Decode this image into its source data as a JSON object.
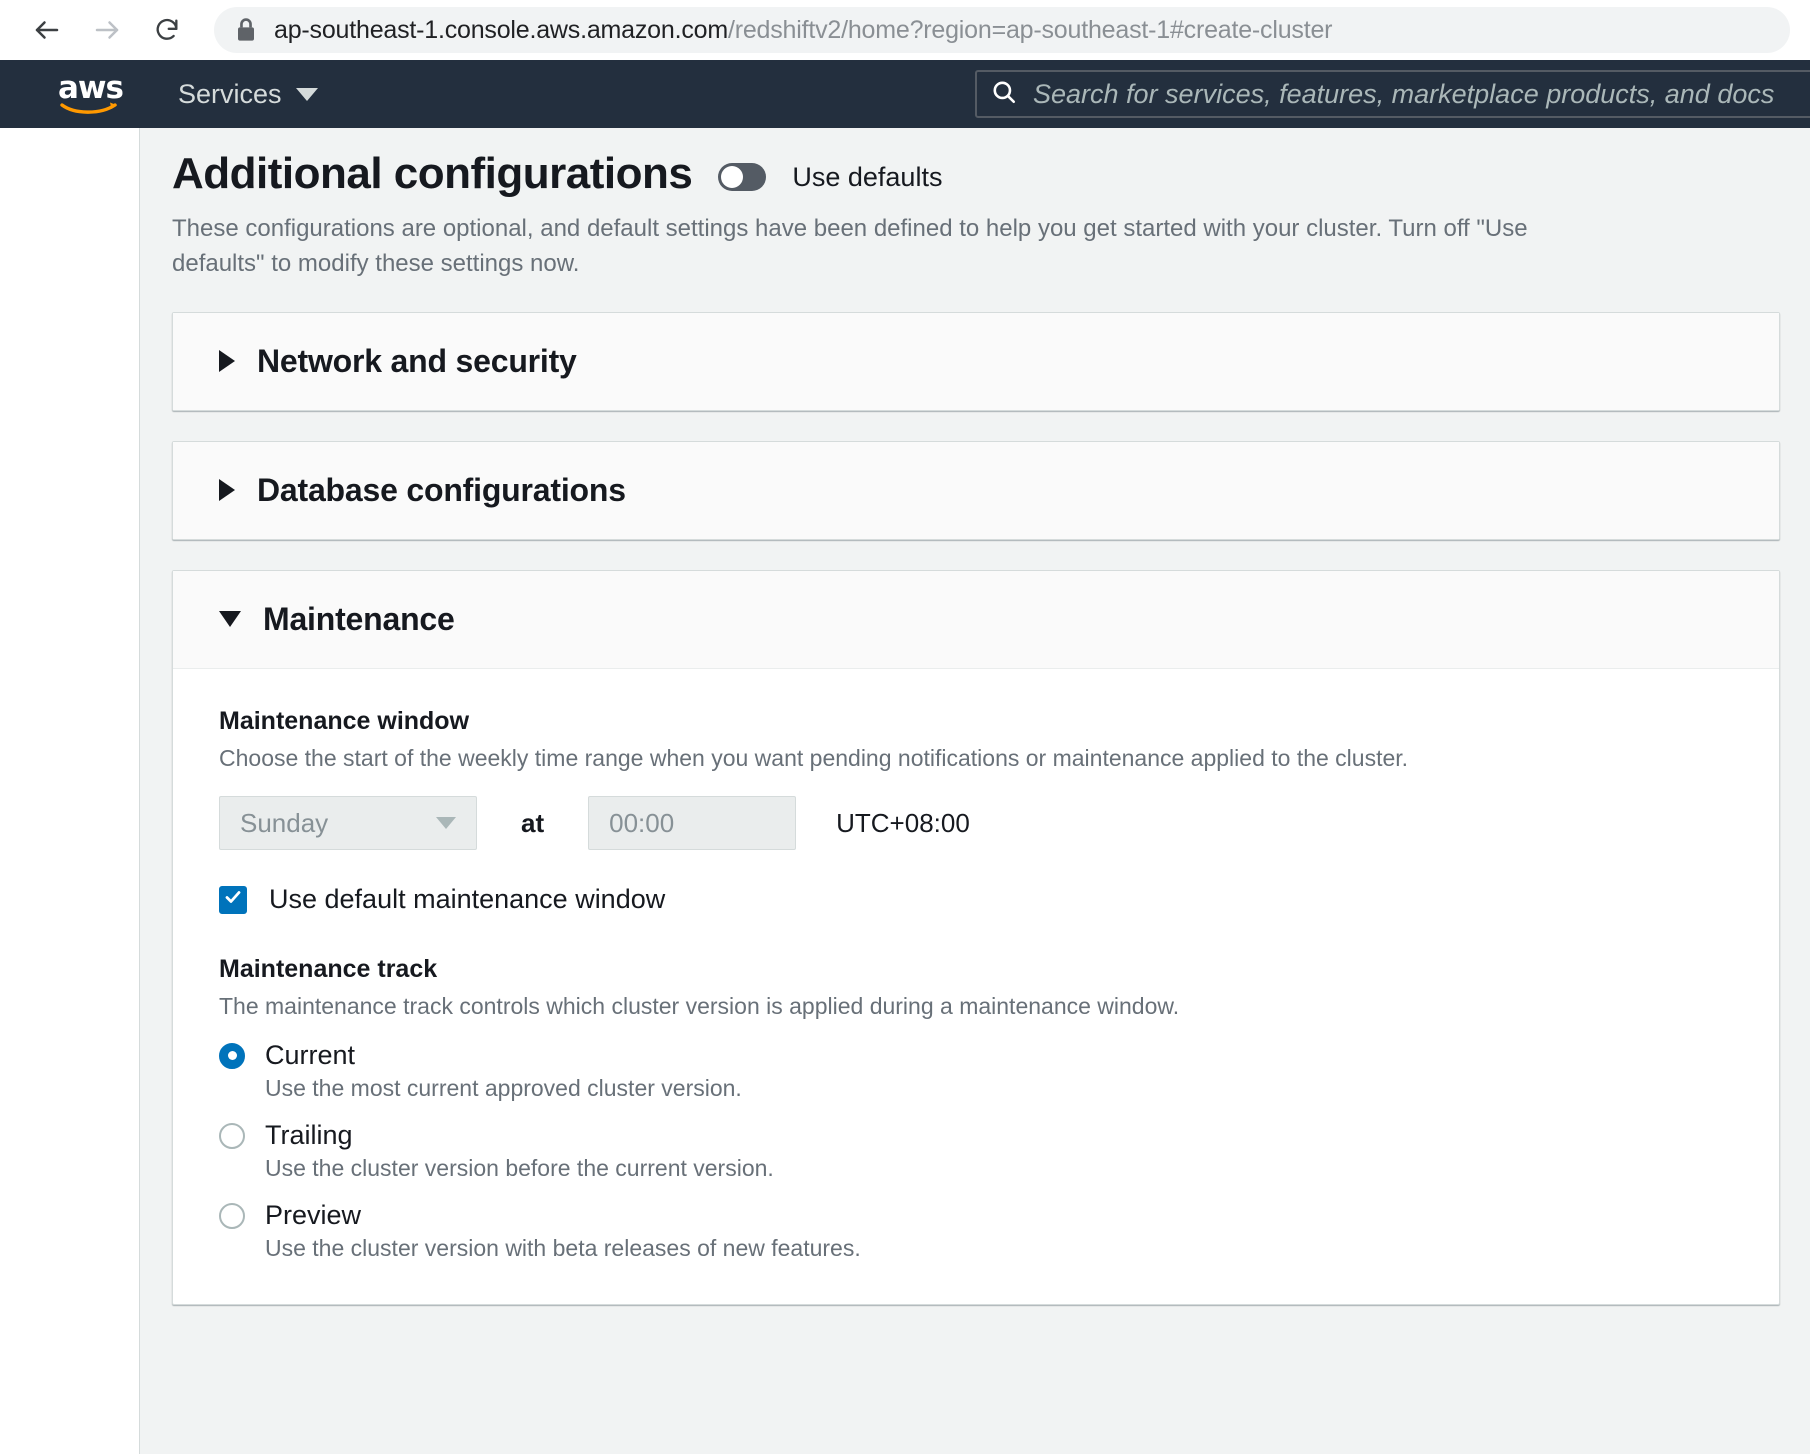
{
  "browser": {
    "back_icon": "back-arrow-icon",
    "forward_icon": "forward-arrow-icon",
    "reload_icon": "reload-icon",
    "lock_icon": "lock-icon",
    "url_host": "ap-southeast-1.console.aws.amazon.com",
    "url_path": "/redshiftv2/home?region=ap-southeast-1#create-cluster"
  },
  "awsnav": {
    "logo": "aws",
    "services_label": "Services",
    "search_placeholder": "Search for services, features, marketplace products, and docs"
  },
  "page": {
    "title": "Additional configurations",
    "use_defaults_label": "Use defaults",
    "use_defaults_on": false,
    "description": "These configurations are optional, and default settings have been defined to help you get started with your cluster. Turn off \"Use defaults\" to modify these settings now."
  },
  "sections": [
    {
      "title": "Network and security",
      "expanded": false
    },
    {
      "title": "Database configurations",
      "expanded": false
    },
    {
      "title": "Maintenance",
      "expanded": true
    }
  ],
  "maintenance": {
    "window": {
      "label": "Maintenance window",
      "hint": "Choose the start of the weekly time range when you want pending notifications or maintenance applied to the cluster.",
      "day_value": "Sunday",
      "at_label": "at",
      "time_value": "00:00",
      "timezone": "UTC+08:00",
      "use_default_label": "Use default maintenance window",
      "use_default_checked": true
    },
    "track": {
      "label": "Maintenance track",
      "hint": "The maintenance track controls which cluster version is applied during a maintenance window.",
      "selected": "Current",
      "options": [
        {
          "label": "Current",
          "desc": "Use the most current approved cluster version.",
          "selected": true
        },
        {
          "label": "Trailing",
          "desc": "Use the cluster version before the current version.",
          "selected": false
        },
        {
          "label": "Preview",
          "desc": "Use the cluster version with beta releases of new features.",
          "selected": false
        }
      ]
    }
  },
  "colors": {
    "aws_navy": "#232f3e",
    "aws_orange": "#ff9900",
    "accent_blue": "#0073bb",
    "page_bg": "#f1f3f3"
  }
}
